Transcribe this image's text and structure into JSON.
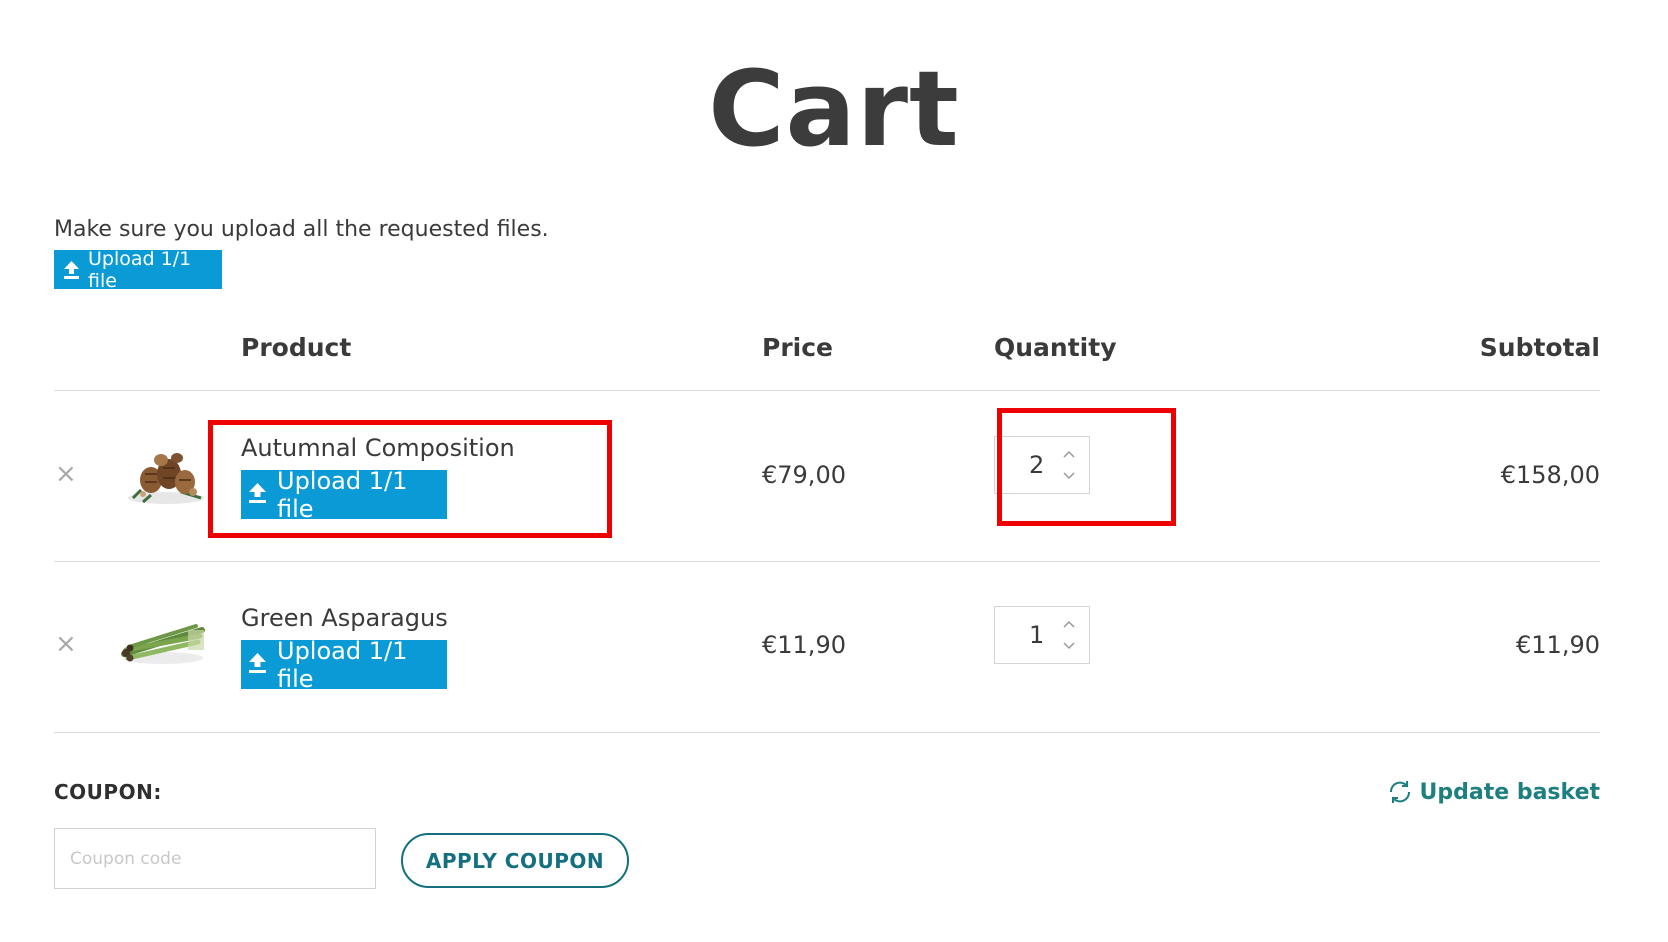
{
  "page": {
    "title": "Cart"
  },
  "notice": {
    "text": "Make sure you upload all the requested files.",
    "upload_label": "Upload 1/1 file"
  },
  "table": {
    "headers": {
      "product": "Product",
      "price": "Price",
      "quantity": "Quantity",
      "subtotal": "Subtotal"
    },
    "rows": [
      {
        "remove": "×",
        "name": "Autumnal Composition",
        "upload_label": "Upload 1/1 file",
        "price": "€79,00",
        "quantity": "2",
        "subtotal": "€158,00",
        "thumbnail": "pinecone-arrangement-image"
      },
      {
        "remove": "×",
        "name": "Green Asparagus",
        "upload_label": "Upload 1/1 file",
        "price": "€11,90",
        "quantity": "1",
        "subtotal": "€11,90",
        "thumbnail": "asparagus-bundle-image"
      }
    ]
  },
  "coupon": {
    "label": "COUPON:",
    "placeholder": "Coupon code",
    "apply_label": "APPLY COUPON"
  },
  "update_basket": {
    "label": "Update basket",
    "icon": "refresh-icon"
  },
  "colors": {
    "upload_button": "#0a9bd6",
    "accent_teal": "#146f7f",
    "highlight_red": "#ee0000"
  }
}
